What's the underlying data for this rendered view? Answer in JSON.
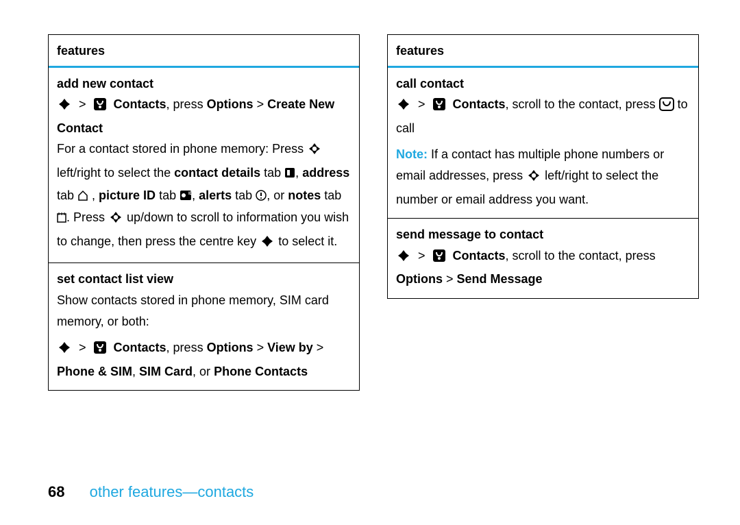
{
  "left": {
    "features": "features",
    "add_new_title": "add new contact",
    "add_new_path1": "Contacts",
    "add_new_path2": ", press ",
    "add_new_path3": "Options",
    "add_new_path4": " > ",
    "add_new_path5": "Create New Contact",
    "body1a": "For a contact stored in phone memory: Press ",
    "body1b": " left/right to select the ",
    "body1c": "contact details",
    "body1d": " tab ",
    "body1e": ", ",
    "body1f": "address",
    "body1g": " tab ",
    "body1h": " , ",
    "body1i": "picture ID",
    "body1j": " tab ",
    "body1k": ", ",
    "body1l": "alerts",
    "body1m": " tab ",
    "body1n": ", or ",
    "body1o": "notes",
    "body1p": " tab ",
    "body1q": ". Press ",
    "body1r": " up/down to scroll to information you wish to change, then press the centre key ",
    "body1s": " to select it.",
    "set_view_title": "set contact list view",
    "set_view_body": "Show contacts stored in phone memory, SIM card memory, or both:",
    "set_path1": "Contacts",
    "set_path2": ", press ",
    "set_path3": "Options",
    "set_path4": " > ",
    "set_path5": "View by",
    "set_path6": " > ",
    "set_path7": "Phone & SIM",
    "set_path8": ", ",
    "set_path9": "SIM Card",
    "set_path10": ", or ",
    "set_path11": "Phone Contacts"
  },
  "right": {
    "features": "features",
    "call_title": "call contact",
    "call_path1": "Contacts",
    "call_path2": ", scroll to the contact, press ",
    "call_path3": " to call",
    "note_label": "Note:",
    "note_body": " If a contact has multiple phone numbers or email addresses, press ",
    "note_body2": " left/right to select the number or email address you want.",
    "send_title": "send message to contact",
    "send_path1": "Contacts",
    "send_path2": ", scroll to the contact, press ",
    "send_path3": "Options",
    "send_path4": " > ",
    "send_path5": "Send Message"
  },
  "footer": {
    "page": "68",
    "section": "other features—contacts"
  }
}
